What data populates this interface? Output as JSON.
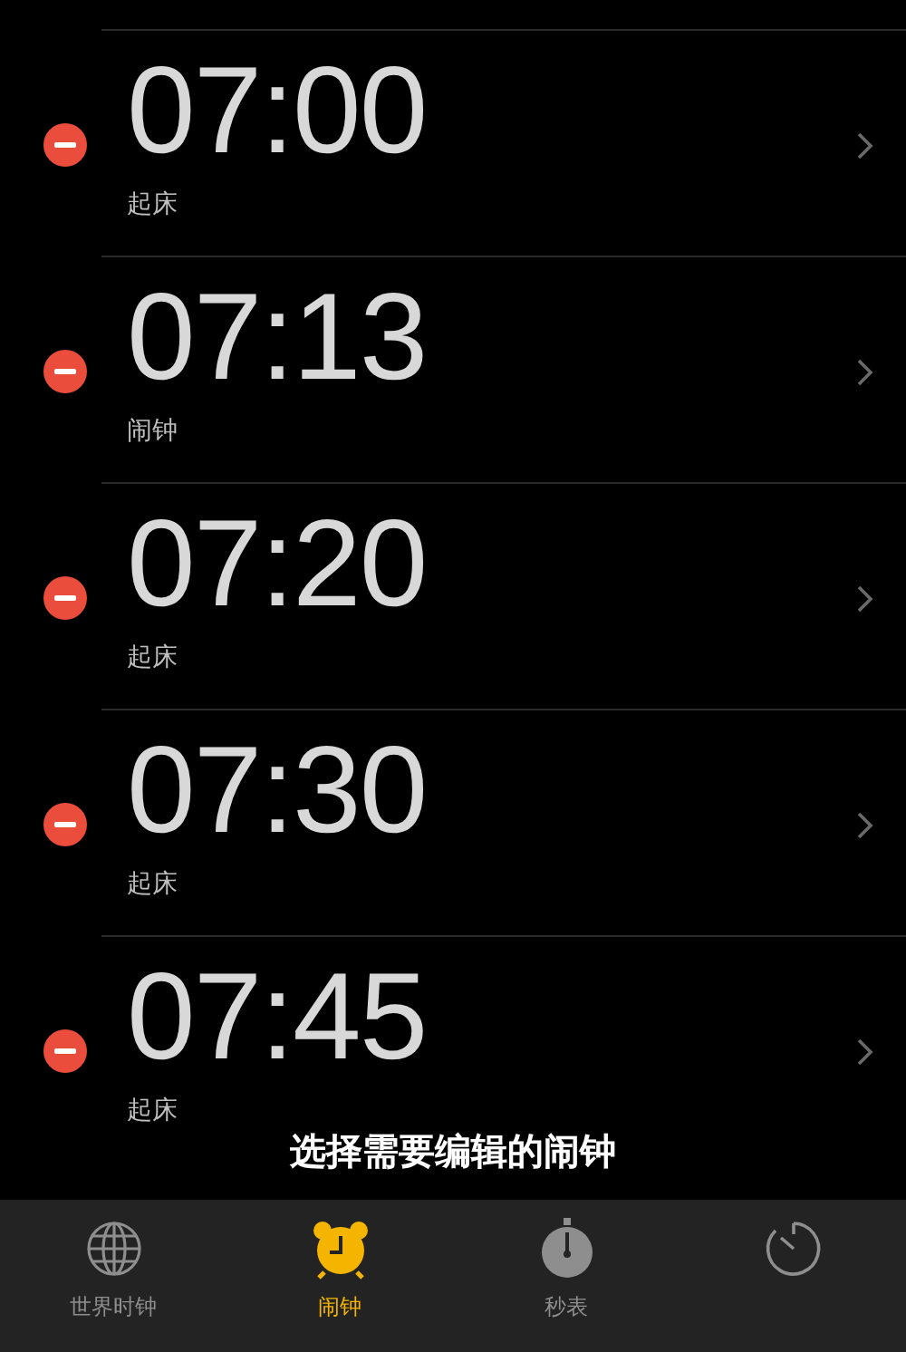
{
  "alarms": [
    {
      "time": "07:00",
      "label": "起床"
    },
    {
      "time": "07:13",
      "label": "闹钟"
    },
    {
      "time": "07:20",
      "label": "起床"
    },
    {
      "time": "07:30",
      "label": "起床"
    },
    {
      "time": "07:45",
      "label": "起床"
    }
  ],
  "caption": "选择需要编辑的闹钟",
  "tabs": [
    {
      "kind": "globe",
      "label": "世界时钟",
      "selected": false
    },
    {
      "kind": "alarm",
      "label": "闹钟",
      "selected": true
    },
    {
      "kind": "stopwatch",
      "label": "秒表",
      "selected": false
    },
    {
      "kind": "timer",
      "selected": false
    }
  ]
}
